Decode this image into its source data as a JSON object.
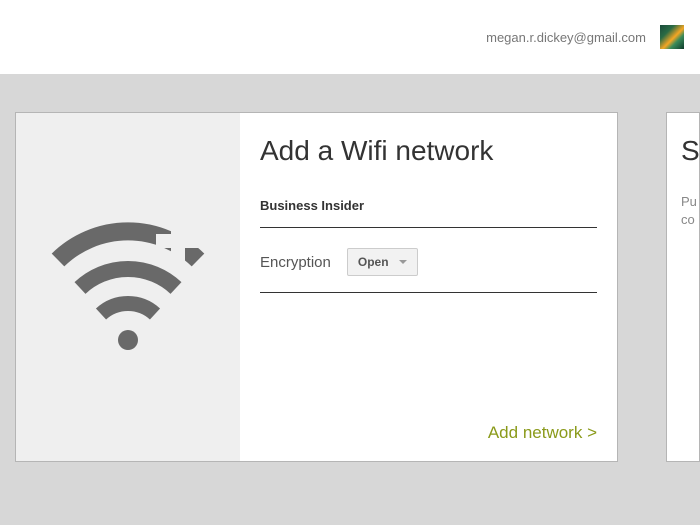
{
  "header": {
    "email": "megan.r.dickey@gmail.com"
  },
  "card": {
    "title": "Add a Wifi network",
    "ssid_value": "Business Insider",
    "encryption_label": "Encryption",
    "encryption_selected": "Open",
    "add_button_label": "Add network >"
  },
  "side_card": {
    "title_partial": "S",
    "body_line1": "Pu",
    "body_line2": "co"
  }
}
